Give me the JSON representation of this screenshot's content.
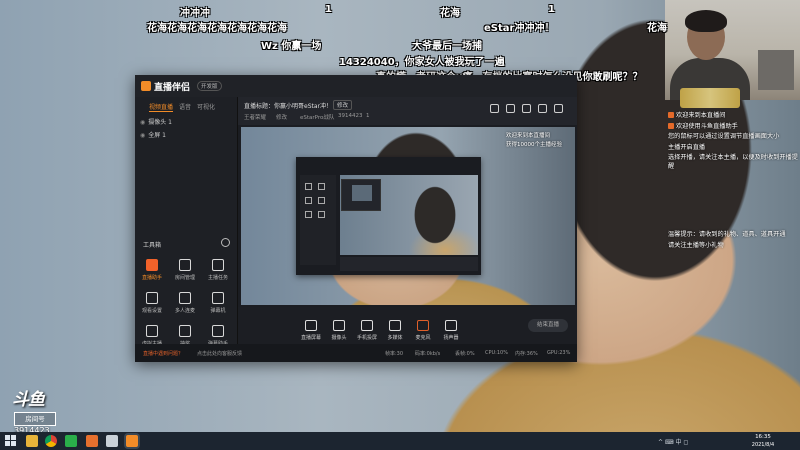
{
  "danmaku": [
    {
      "id": "dm-1",
      "text": "冲冲冲"
    },
    {
      "id": "dm-2",
      "text": "1"
    },
    {
      "id": "dm-3",
      "text": "花海"
    },
    {
      "id": "dm-4",
      "text": "1"
    },
    {
      "id": "dm-5",
      "text": "花海花海花海花海花海花海花海"
    },
    {
      "id": "dm-6",
      "text": "eStar冲冲冲！"
    },
    {
      "id": "dm-7",
      "text": "花海"
    },
    {
      "id": "dm-8",
      "text": "Wz 你赢一场"
    },
    {
      "id": "dm-9",
      "text": "大爷最后一场捕"
    },
    {
      "id": "dm-10",
      "text": "14324040，你家女人被我玩了一遍"
    },
    {
      "id": "dm-11",
      "text": "真的慌，考研这个x痛，存档的比赛时怎么没见你敢刷呢？？"
    }
  ],
  "chat": [
    "欢迎来到本直播间",
    "欢迎使用斗鱼直播助手",
    "您的鼠标可以通过设置调节直播画面大小",
    "主播开启直播",
    "选择开播，请关注本主播，以便及时收到开播提醒",
    "温馨提示：请收到的礼物、道具、道具开通",
    "请关注主播等小礼物"
  ],
  "app": {
    "logo_text": "直播伴侣",
    "logo_tag": "开发版",
    "left_tabs": [
      "视频直播",
      "语音",
      "可视化"
    ],
    "scenes": [
      {
        "label": "摄像头 1"
      },
      {
        "label": "全屏 1"
      }
    ],
    "tools_title": "工具箱",
    "tools": [
      {
        "label": "直播助手"
      },
      {
        "label": "房间管理"
      },
      {
        "label": "主播任务"
      },
      {
        "label": "观看设置"
      },
      {
        "label": "多人连麦"
      },
      {
        "label": "弹幕机"
      },
      {
        "label": "虚拟主播"
      },
      {
        "label": "抽奖"
      },
      {
        "label": "弹幕助手"
      },
      {
        "label": "更多"
      }
    ],
    "preview_title": "直播标题：你赢小明哥eStar冲！",
    "preview_edit": "修改",
    "preview_sub": [
      "王者荣耀",
      "修改",
      "eStarPro战队",
      "3914423",
      "1"
    ],
    "preview_dm": [
      "欢迎来到本直播间",
      "获得10000个主播经验"
    ],
    "bottom_buttons": [
      "直播屏幕",
      "摄像头",
      "手机投屏",
      "多媒体",
      "麦克风",
      "扬声器"
    ],
    "go_live": "结束直播",
    "status": {
      "warning": "直播中遇到问题？",
      "hint": "点击此处向客服反馈",
      "stats": [
        "帧率:30",
        "码率:0kb/s",
        "丢帧:0%",
        "CPU:10%",
        "内存:36%",
        "GPU:23%"
      ]
    }
  },
  "watermark": {
    "logo": "斗鱼",
    "box": "房间号",
    "room": "3914423"
  },
  "taskbar": {
    "time": "16:35",
    "date": "2021/8/4",
    "tray": "^  ⌨  中  ◻"
  }
}
